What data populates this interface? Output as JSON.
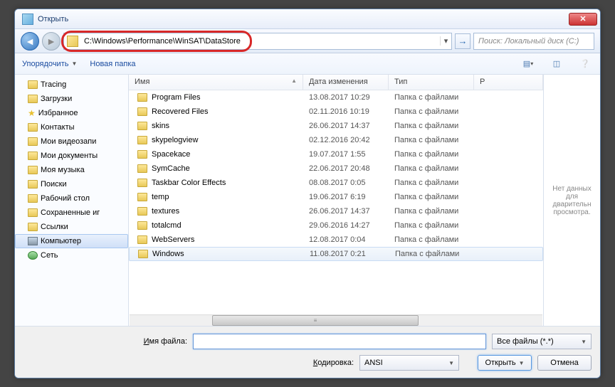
{
  "title": "Открыть",
  "address": "C:\\Windows\\Performance\\WinSAT\\DataStore",
  "search_placeholder": "Поиск: Локальный диск (C:)",
  "toolbar": {
    "organize": "Упорядочить",
    "new_folder": "Новая папка"
  },
  "tree": [
    {
      "icon": "folder",
      "label": "Tracing"
    },
    {
      "icon": "folder",
      "label": "Загрузки"
    },
    {
      "icon": "star",
      "label": "Избранное"
    },
    {
      "icon": "folder",
      "label": "Контакты"
    },
    {
      "icon": "folder",
      "label": "Мои видеозапи"
    },
    {
      "icon": "folder",
      "label": "Мои документы"
    },
    {
      "icon": "folder",
      "label": "Моя музыка"
    },
    {
      "icon": "folder",
      "label": "Поиски"
    },
    {
      "icon": "folder",
      "label": "Рабочий стол"
    },
    {
      "icon": "folder",
      "label": "Сохраненные иг"
    },
    {
      "icon": "folder",
      "label": "Ссылки"
    },
    {
      "icon": "computer",
      "label": "Компьютер",
      "selected": true
    },
    {
      "icon": "network",
      "label": "Сеть"
    }
  ],
  "columns": {
    "name": "Имя",
    "date": "Дата изменения",
    "type": "Тип",
    "size": "Р"
  },
  "files": [
    {
      "name": "Program Files",
      "date": "13.08.2017 10:29",
      "type": "Папка с файлами"
    },
    {
      "name": "Recovered Files",
      "date": "02.11.2016 10:19",
      "type": "Папка с файлами"
    },
    {
      "name": "skins",
      "date": "26.06.2017 14:37",
      "type": "Папка с файлами"
    },
    {
      "name": "skypelogview",
      "date": "02.12.2016 20:42",
      "type": "Папка с файлами"
    },
    {
      "name": "Spacekace",
      "date": "19.07.2017 1:55",
      "type": "Папка с файлами"
    },
    {
      "name": "SymCache",
      "date": "22.06.2017 20:48",
      "type": "Папка с файлами"
    },
    {
      "name": "Taskbar Color Effects",
      "date": "08.08.2017 0:05",
      "type": "Папка с файлами"
    },
    {
      "name": "temp",
      "date": "19.06.2017 6:19",
      "type": "Папка с файлами"
    },
    {
      "name": "textures",
      "date": "26.06.2017 14:37",
      "type": "Папка с файлами"
    },
    {
      "name": "totalcmd",
      "date": "29.06.2016 14:27",
      "type": "Папка с файлами"
    },
    {
      "name": "WebServers",
      "date": "12.08.2017 0:04",
      "type": "Папка с файлами"
    },
    {
      "name": "Windows",
      "date": "11.08.2017 0:21",
      "type": "Папка с файлами",
      "selected": true
    }
  ],
  "preview_text": "Нет данных для дварительн просмотра.",
  "footer": {
    "filename_label": "Имя файла:",
    "encoding_label": "Кодировка:",
    "filter": "Все файлы (*.*)",
    "encoding": "ANSI",
    "open": "Открыть",
    "cancel": "Отмена"
  }
}
